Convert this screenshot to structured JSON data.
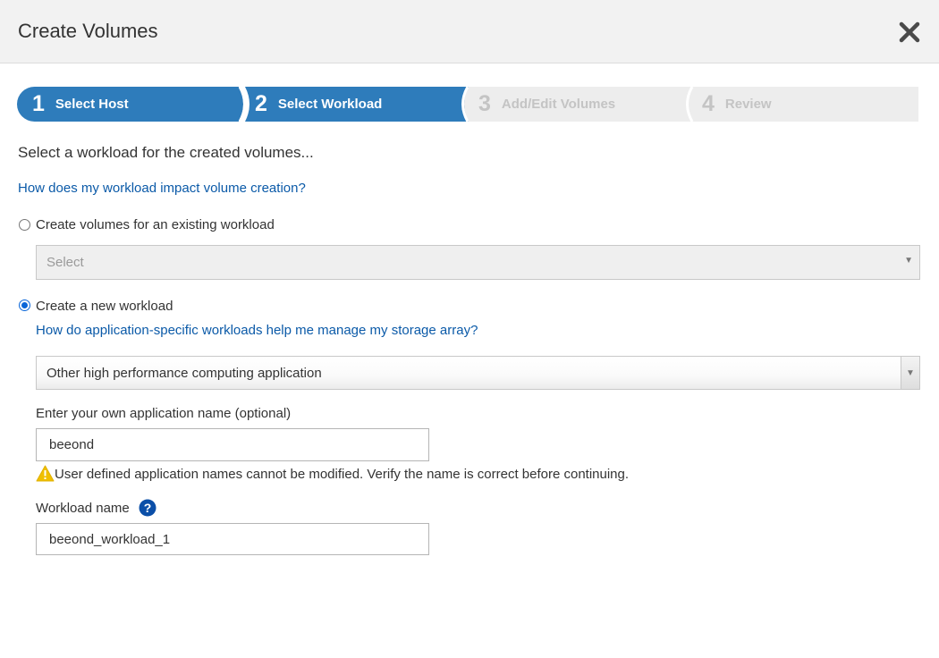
{
  "dialog": {
    "title": "Create Volumes"
  },
  "wizard": {
    "steps": [
      {
        "number": "1",
        "label": "Select Host",
        "state": "complete"
      },
      {
        "number": "2",
        "label": "Select Workload",
        "state": "active"
      },
      {
        "number": "3",
        "label": "Add/Edit Volumes",
        "state": "inactive"
      },
      {
        "number": "4",
        "label": "Review",
        "state": "inactive"
      }
    ]
  },
  "content": {
    "intro": "Select a workload for the created volumes...",
    "help_link": "How does my workload impact volume creation?",
    "existing_option": {
      "label": "Create volumes for an existing workload",
      "checked": false,
      "select_placeholder": "Select"
    },
    "new_option": {
      "label": "Create a new workload",
      "checked": true,
      "help_link": "How do application-specific workloads help me manage my storage array?",
      "application_selected": "Other high performance computing application"
    },
    "app_name": {
      "label": "Enter your own application name (optional)",
      "value": "beeond"
    },
    "warning": "User defined application names cannot be modified. Verify the name is correct before continuing.",
    "workload_name": {
      "label": "Workload name",
      "value": "beeond_workload_1"
    }
  },
  "colors": {
    "wizard_active": "#2e7cbb",
    "wizard_inactive": "#ededed",
    "link": "#0b5aa8",
    "warning": "#f0c000",
    "help": "#0b4fa8"
  },
  "icons": {
    "close": "close-icon",
    "warning": "warning-icon",
    "help": "help-icon",
    "dropdown": "chevron-down-icon"
  }
}
